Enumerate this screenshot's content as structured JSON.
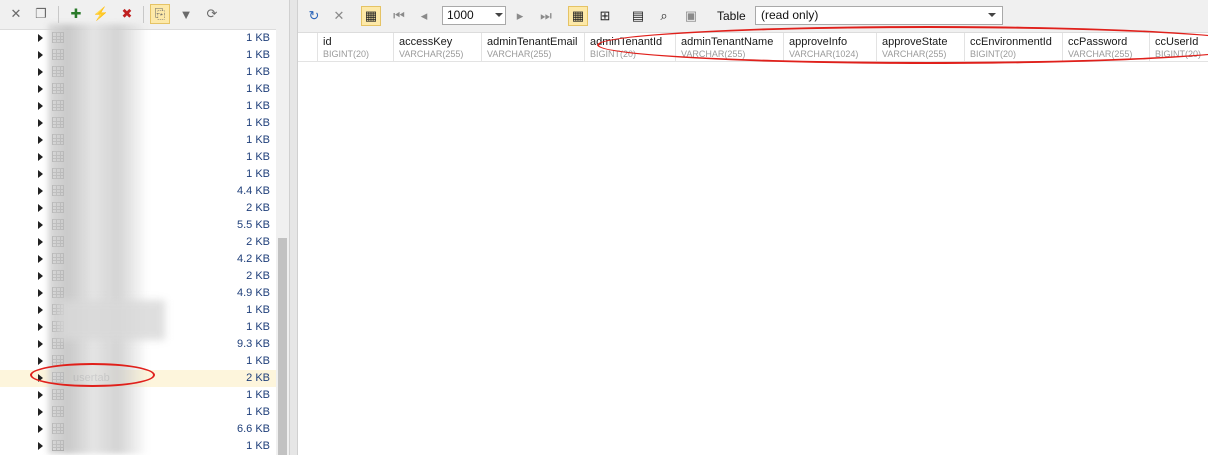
{
  "left_toolbar": {
    "icons": [
      "close-icon",
      "restore-icon",
      "add-connection-icon",
      "disconnect-icon",
      "close-connection-icon",
      "copy-icon",
      "filter-icon",
      "refresh-icon"
    ]
  },
  "tree": {
    "rows": [
      {
        "name": "",
        "size": "1 KB"
      },
      {
        "name": "",
        "size": "1 KB"
      },
      {
        "name": "",
        "size": "1 KB"
      },
      {
        "name": "",
        "size": "1 KB"
      },
      {
        "name": "",
        "size": "1 KB"
      },
      {
        "name": "",
        "size": "1 KB"
      },
      {
        "name": "",
        "size": "1 KB"
      },
      {
        "name": "",
        "size": "1 KB"
      },
      {
        "name": "",
        "size": "1 KB"
      },
      {
        "name": "",
        "size": "4.4 KB"
      },
      {
        "name": "",
        "size": "2 KB"
      },
      {
        "name": "",
        "size": "5.5 KB"
      },
      {
        "name": "",
        "size": "2 KB"
      },
      {
        "name": "",
        "size": "4.2 KB"
      },
      {
        "name": "",
        "size": "2 KB"
      },
      {
        "name": "",
        "size": "4.9 KB"
      },
      {
        "name": "",
        "size": "1 KB"
      },
      {
        "name": "",
        "size": "1 KB"
      },
      {
        "name": "",
        "size": "9.3 KB"
      },
      {
        "name": "",
        "size": "1 KB"
      },
      {
        "name": "usertab",
        "size": "2 KB"
      },
      {
        "name": "",
        "size": "1 KB"
      },
      {
        "name": "",
        "size": "1 KB"
      },
      {
        "name": "",
        "size": "6.6 KB"
      },
      {
        "name": "",
        "size": "1 KB"
      }
    ]
  },
  "toolbar": {
    "limit_value": "1000",
    "table_label": "Table",
    "table_mode": "(read only)"
  },
  "grid": {
    "columns": [
      {
        "name": "id",
        "type": "BIGINT(20)"
      },
      {
        "name": "accessKey",
        "type": "VARCHAR(255)"
      },
      {
        "name": "adminTenantEmail",
        "type": "VARCHAR(255)"
      },
      {
        "name": "adminTenantId",
        "type": "BIGINT(20)"
      },
      {
        "name": "adminTenantName",
        "type": "VARCHAR(255)"
      },
      {
        "name": "approveInfo",
        "type": "VARCHAR(1024)"
      },
      {
        "name": "approveState",
        "type": "VARCHAR(255)"
      },
      {
        "name": "ccEnvironmentId",
        "type": "BIGINT(20)"
      },
      {
        "name": "ccPassword",
        "type": "VARCHAR(255)"
      },
      {
        "name": "ccUserId",
        "type": "BIGINT(20)"
      }
    ]
  },
  "colors": {
    "annotation": "#e0201b",
    "selected_row": "#fdf5dc",
    "active_toggle": "#fde9a8",
    "size_text": "#1f3f7a"
  }
}
